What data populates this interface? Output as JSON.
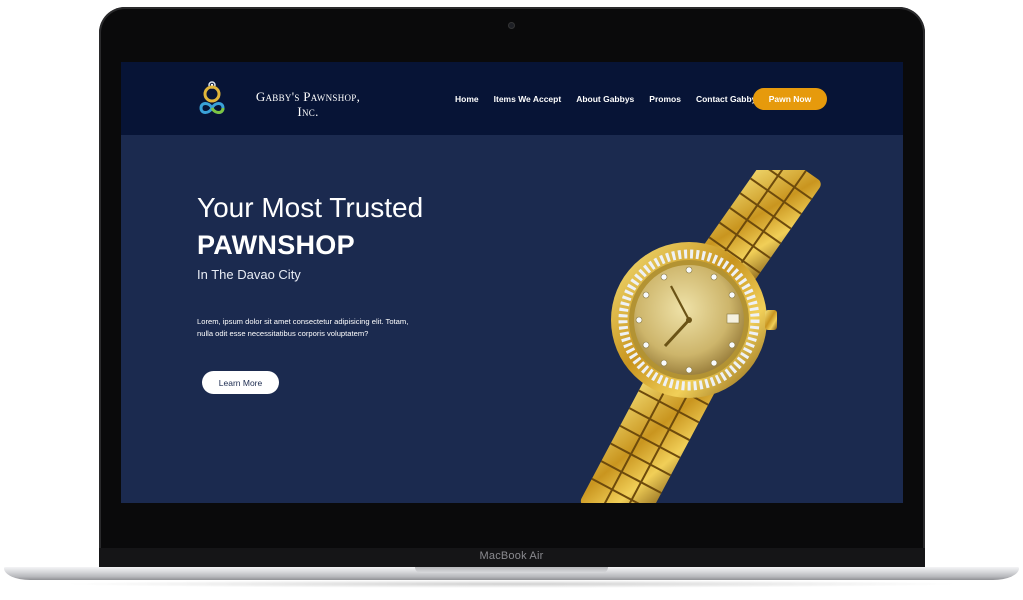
{
  "device": {
    "label": "MacBook Air"
  },
  "site": {
    "brand_line1": "Gabby's Pawnshop,",
    "brand_line2": "Inc.",
    "nav": [
      "Home",
      "Items We Accept",
      "About Gabbys",
      "Promos",
      "Contact Gabbys"
    ],
    "cta_label": "Pawn Now"
  },
  "hero": {
    "line1": "Your Most Trusted",
    "line2": "PAWNSHOP",
    "line3": "In The Davao City",
    "description": "Lorem, ipsum dolor sit amet consectetur adipisicing elit. Totam, nulla odit esse necessitatibus corporis voluptatem?",
    "button_label": "Learn More"
  },
  "colors": {
    "nav_bg": "#071436",
    "hero_bg": "#1b2a4f",
    "accent": "#e69a0c",
    "text": "#ffffff"
  },
  "icons": [
    "camera-icon",
    "logo-rings-icon",
    "watch-image"
  ]
}
